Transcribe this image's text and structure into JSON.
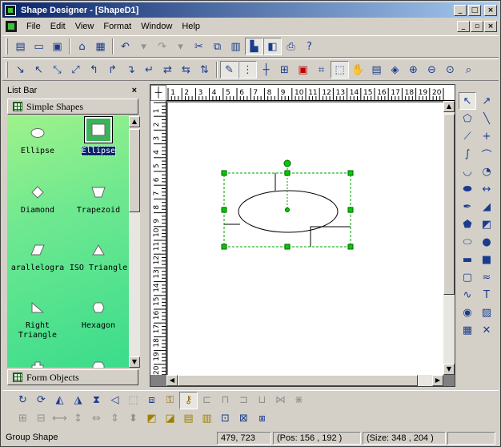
{
  "window": {
    "title": "Shape Designer - [ShapeD1]"
  },
  "menu": {
    "items": [
      "File",
      "Edit",
      "View",
      "Format",
      "Window",
      "Help"
    ]
  },
  "listbar": {
    "title": "List Bar",
    "close": "×",
    "tabs": [
      "Simple Shapes",
      "Form Objects"
    ],
    "shapes": [
      {
        "label": "Ellipse",
        "icon": "ellipse-icon"
      },
      {
        "label": "Ellipse",
        "icon": "rect-icon",
        "selected": true
      },
      {
        "label": "Diamond",
        "icon": "diamond-icon"
      },
      {
        "label": "Trapezoid",
        "icon": "trapezoid-icon"
      },
      {
        "label": "arallelogra",
        "icon": "parallelogram-icon"
      },
      {
        "label": "ISO Triangle",
        "icon": "triangle-icon"
      },
      {
        "label": "Right Triangle",
        "icon": "right-triangle-icon"
      },
      {
        "label": "Hexagon",
        "icon": "hexagon-icon"
      }
    ]
  },
  "ruler": {
    "h_ticks": [
      "1",
      "2",
      "3",
      "4",
      "5",
      "6",
      "7",
      "8",
      "9",
      "10",
      "11",
      "12",
      "13",
      "14",
      "15",
      "16",
      "17",
      "18",
      "19",
      "20"
    ],
    "v_ticks": [
      "1",
      "2",
      "3",
      "4",
      "5",
      "6",
      "7",
      "8",
      "9",
      "10",
      "11",
      "12",
      "13",
      "14",
      "15",
      "16",
      "17",
      "18",
      "19",
      "20"
    ]
  },
  "status": {
    "mode": "Group Shape",
    "coords": "479, 723",
    "pos": "(Pos:  156 , 192 )",
    "size": "(Size: 348 , 204 )"
  },
  "colors": {
    "selection_handle": "#00cc00",
    "titlebar_start": "#0a246a",
    "titlebar_end": "#a6caf0"
  }
}
